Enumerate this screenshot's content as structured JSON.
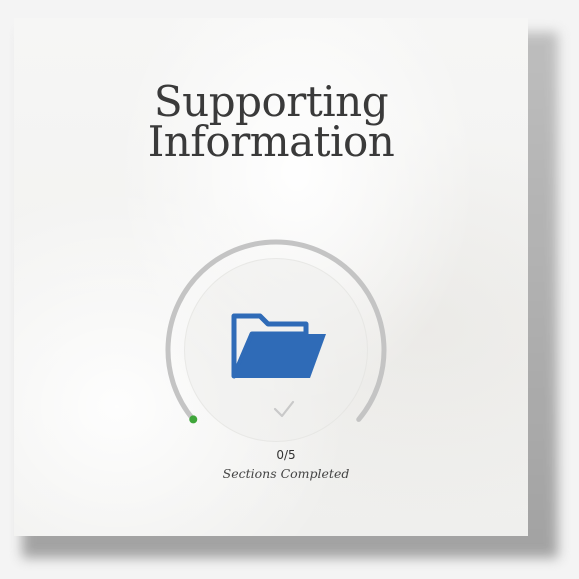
{
  "widget": {
    "title_line1": "Supporting",
    "title_line2": "Information",
    "progress": {
      "completed": 0,
      "total": 5,
      "fraction": 0,
      "count_text": "0/5",
      "caption": "Sections Completed"
    },
    "icons": {
      "main": "folder-open-icon",
      "status": "checkmark-icon"
    },
    "colors": {
      "folder": "#2f6bb7",
      "ring_track": "#c4c4c4",
      "progress_start_dot": "#3fa63a",
      "check": "#c9c9c9"
    }
  }
}
